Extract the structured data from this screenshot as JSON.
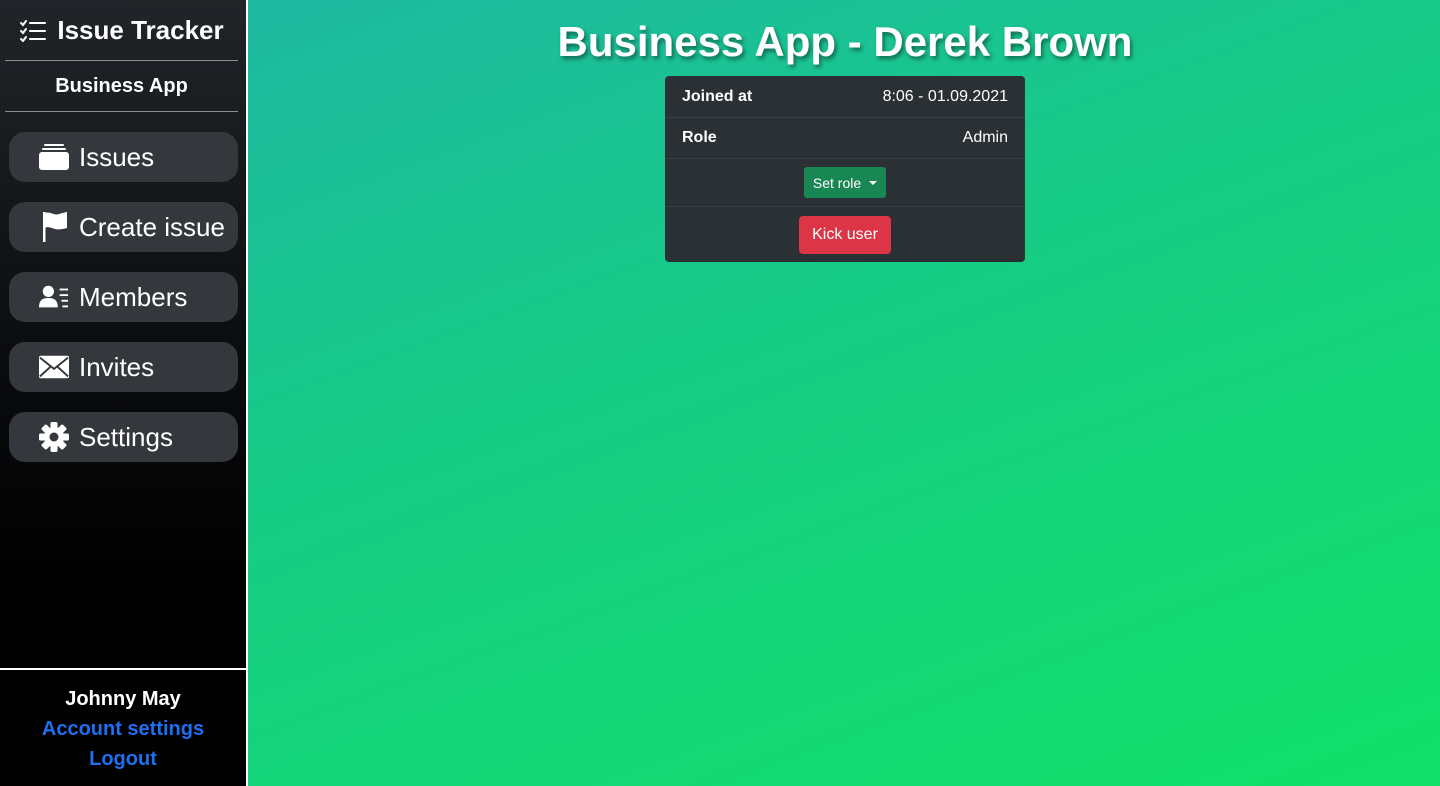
{
  "sidebar": {
    "brand_title": "Issue Tracker",
    "workspace_name": "Business App",
    "items": [
      {
        "label": "Issues",
        "icon": "inbox-stack-icon"
      },
      {
        "label": "Create issue",
        "icon": "flag-icon"
      },
      {
        "label": "Members",
        "icon": "person-lines-icon"
      },
      {
        "label": "Invites",
        "icon": "envelope-icon"
      },
      {
        "label": "Settings",
        "icon": "gear-icon"
      }
    ],
    "user": {
      "name": "Johnny May",
      "account_settings_label": "Account settings",
      "logout_label": "Logout"
    }
  },
  "main": {
    "title": "Business App - Derek Brown",
    "member_card": {
      "joined_label": "Joined at",
      "joined_value": "8:06 - 01.09.2021",
      "role_label": "Role",
      "role_value": "Admin",
      "set_role_label": "Set role",
      "kick_label": "Kick user"
    }
  },
  "colors": {
    "background_gradient_start": "#1fb5a6",
    "background_gradient_end": "#10e068",
    "sidebar_bg": "#000000",
    "nav_item_bg": "#34373b",
    "card_bg": "#2b3035",
    "set_role_bg": "#198754",
    "kick_bg": "#dc3545",
    "link": "#1e6ff1"
  }
}
